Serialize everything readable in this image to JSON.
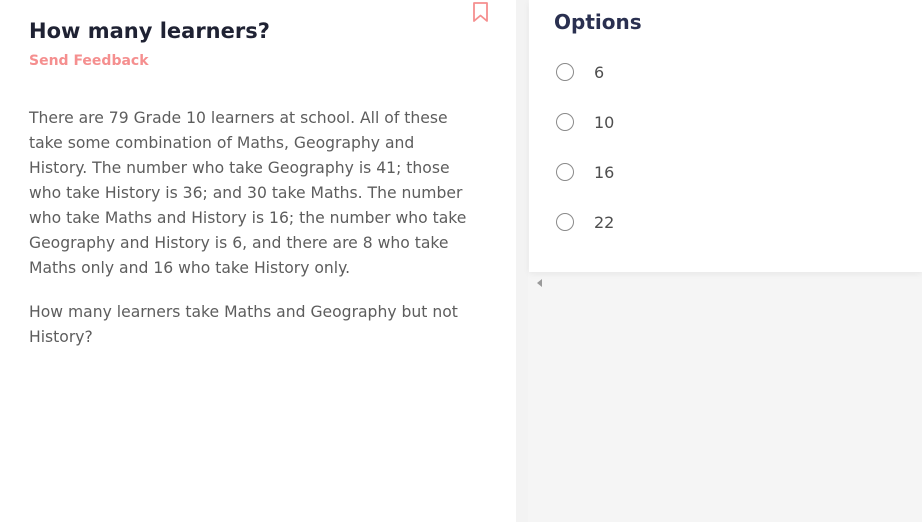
{
  "question": {
    "title": "How many learners?",
    "feedback_label": "Send Feedback",
    "paragraphs": [
      "There are 79 Grade 10 learners at school. All of these take some combination of Maths, Geography and History. The number who take Geography is 41; those who take History is 36; and 30 take Maths. The number who take Maths and History is 16; the number who take Geography and History is 6, and there are 8 who take Maths only and 16 who take History only.",
      "How many learners take Maths and Geography but not History?"
    ],
    "bookmark_icon": "bookmark-outline-icon"
  },
  "options": {
    "title": "Options",
    "items": [
      {
        "label": "6"
      },
      {
        "label": "10"
      },
      {
        "label": "16"
      },
      {
        "label": "22"
      }
    ]
  },
  "icons": {
    "scroll_left": "scroll-left-arrow-icon"
  },
  "colors": {
    "accent": "#f58f8f",
    "title": "#1f2233",
    "options_title": "#2a3050",
    "body_text": "#5d5d5d",
    "radio_border": "#8a8a8a"
  }
}
